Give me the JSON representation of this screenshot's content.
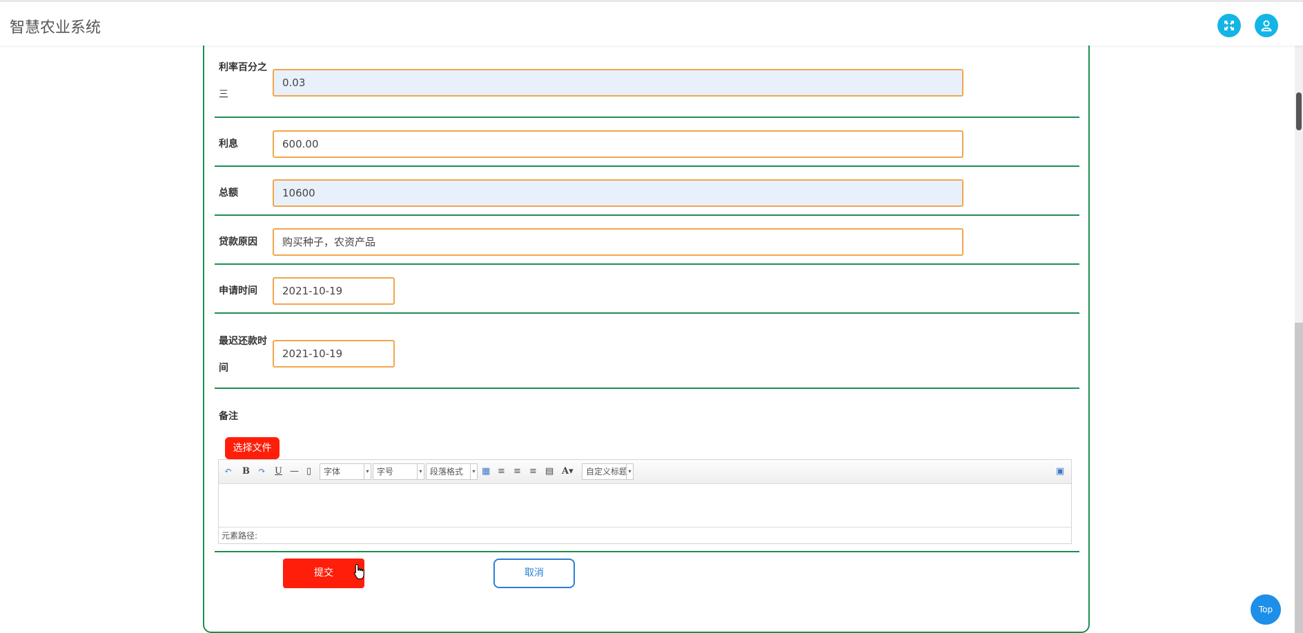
{
  "header": {
    "app_title": "智慧农业系统",
    "fullscreen_icon": "fullscreen-icon",
    "user_icon": "user-icon",
    "accent_color": "#13b5e6"
  },
  "form": {
    "rate": {
      "label_line1": "利率百分之",
      "label_line2": "三",
      "value": "0.03"
    },
    "interest": {
      "label": "利息",
      "value": "600.00"
    },
    "total": {
      "label": "总额",
      "value": "10600"
    },
    "reason": {
      "label": "贷款原因",
      "value": "购买种子，农资产品"
    },
    "apply_date": {
      "label": "申请时间",
      "value": "2021-10-19"
    },
    "latest_repay": {
      "label_line1": "最迟还款时",
      "label_line2": "间",
      "value": "2021-10-19"
    },
    "remark": {
      "label": "备注"
    },
    "upload_button": "选择文件",
    "editor": {
      "font_family": "字体",
      "font_size": "字号",
      "paragraph": "段落格式",
      "custom_title": "自定义标题",
      "path_label": "元素路径:"
    },
    "submit_button": "提交",
    "cancel_button": "取消"
  },
  "scroll_top_button": "Top",
  "colors": {
    "border_green": "#1a8f4e",
    "input_orange": "#f0a64a",
    "primary_red": "#ff1e0a",
    "link_blue": "#2a7fd4"
  }
}
